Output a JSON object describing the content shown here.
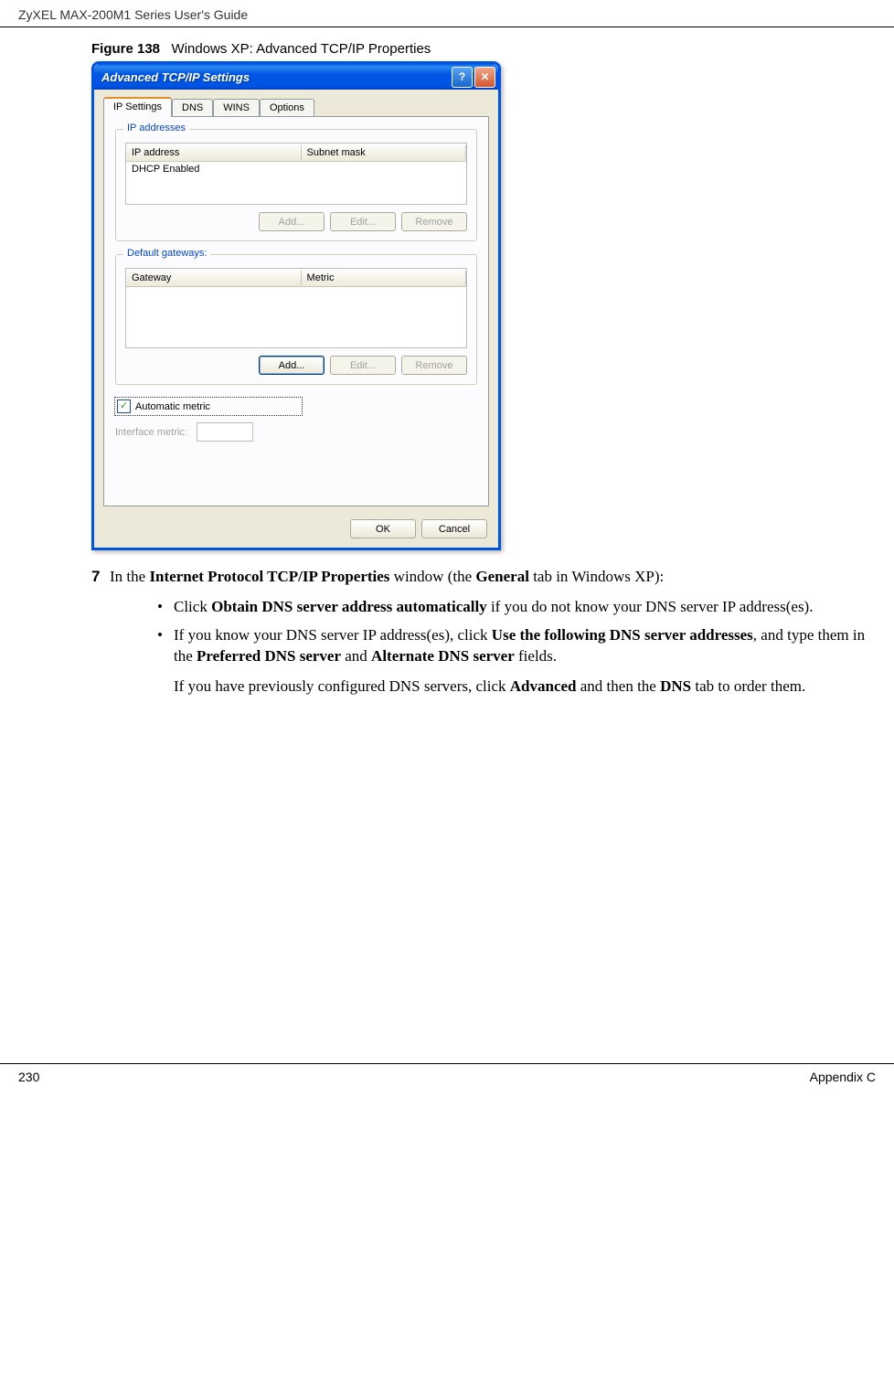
{
  "page": {
    "header": "ZyXEL MAX-200M1 Series User's Guide",
    "footer_left": "230",
    "footer_right": "Appendix C"
  },
  "figure": {
    "label": "Figure 138",
    "caption": "Windows XP: Advanced TCP/IP Properties"
  },
  "dialog": {
    "title": "Advanced TCP/IP Settings",
    "tabs": [
      "IP Settings",
      "DNS",
      "WINS",
      "Options"
    ],
    "ip_group": {
      "legend": "IP addresses",
      "col1": "IP address",
      "col2": "Subnet mask",
      "row1": "DHCP Enabled",
      "btn_add": "Add...",
      "btn_edit": "Edit...",
      "btn_remove": "Remove"
    },
    "gw_group": {
      "legend": "Default gateways:",
      "col1": "Gateway",
      "col2": "Metric",
      "btn_add": "Add...",
      "btn_edit": "Edit...",
      "btn_remove": "Remove"
    },
    "auto_metric": "Automatic metric",
    "interface_metric": "Interface metric:",
    "ok": "OK",
    "cancel": "Cancel"
  },
  "content": {
    "step_num": "7",
    "step_text_1": "In the ",
    "step_bold_1": "Internet Protocol TCP/IP Properties",
    "step_text_2": " window (the ",
    "step_bold_2": "General",
    "step_text_3": " tab in Windows XP):",
    "b1_1": "Click ",
    "b1_bold": "Obtain DNS server address automatically",
    "b1_2": " if you do not know your DNS server IP address(es).",
    "b2_1": "If you know your DNS server IP address(es), click ",
    "b2_bold1": "Use the following DNS server addresses",
    "b2_2": ", and type them in the ",
    "b2_bold2": "Preferred DNS server",
    "b2_3": " and ",
    "b2_bold3": "Alternate DNS server",
    "b2_4": " fields.",
    "p_1": "If you have previously configured DNS servers, click ",
    "p_bold1": "Advanced",
    "p_2": " and then the ",
    "p_bold2": "DNS",
    "p_3": " tab to order them."
  }
}
